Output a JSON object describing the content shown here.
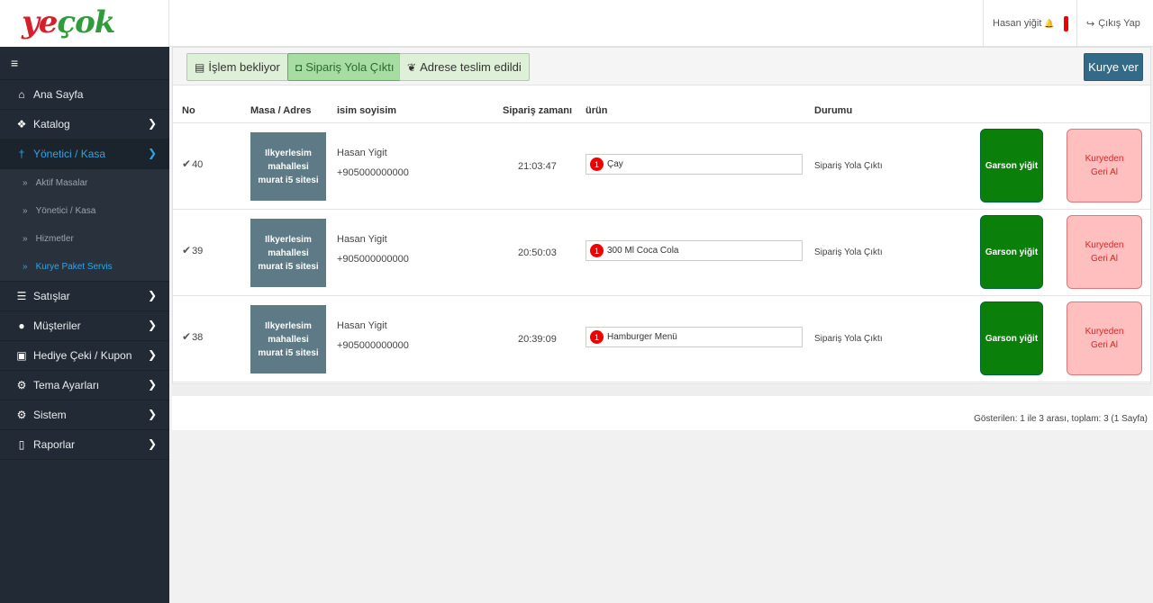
{
  "logo": {
    "part1": "ye",
    "part2": "çok"
  },
  "header": {
    "user": "Hasan yiğit",
    "logout": "Çıkış Yap"
  },
  "sidebar": {
    "toggle_icon": "≡",
    "items": [
      {
        "label": "Ana Sayfa",
        "icon": "home-icon"
      },
      {
        "label": "Katalog",
        "icon": "tags-icon"
      },
      {
        "label": "Yönetici / Kasa",
        "icon": "utensils-icon"
      },
      {
        "label": "Satışlar",
        "icon": "cart-icon"
      },
      {
        "label": "Müşteriler",
        "icon": "user-icon"
      },
      {
        "label": "Hediye Çeki / Kupon",
        "icon": "gift-icon"
      },
      {
        "label": "Tema Ayarları",
        "icon": "cogs-icon"
      },
      {
        "label": "Sistem",
        "icon": "gear-icon"
      },
      {
        "label": "Raporlar",
        "icon": "file-icon"
      }
    ],
    "sub_items": [
      "Aktif Masalar",
      "Yönetici / Kasa",
      "Hizmetler",
      "Kurye Paket Servis"
    ]
  },
  "toolbar": {
    "filter1": "İşlem bekliyor",
    "filter2": "Sipariş Yola Çıktı",
    "filter3": "Adrese teslim edildi",
    "kurye_ver": "Kurye ver"
  },
  "table": {
    "headers": {
      "no": "No",
      "address": "Masa / Adres",
      "name": "isim soyisim",
      "time": "Sipariş zamanı",
      "product": "ürün",
      "status": "Durumu"
    },
    "rows": [
      {
        "no": "40",
        "address": "Ilkyerlesim mahallesi murat i5 sitesi",
        "name": "Hasan Yigit",
        "phone": "+905000000000",
        "time": "21:03:47",
        "qty": "1",
        "product": "Çay",
        "status": "Sipariş Yola Çıktı",
        "garson": "Garson yiğit",
        "geri": "Kuryeden Geri Al"
      },
      {
        "no": "39",
        "address": "Ilkyerlesim mahallesi murat i5 sitesi",
        "name": "Hasan Yigit",
        "phone": "+905000000000",
        "time": "20:50:03",
        "qty": "1",
        "product": "300 Ml Coca Cola",
        "status": "Sipariş Yola Çıktı",
        "garson": "Garson yiğit",
        "geri": "Kuryeden Geri Al"
      },
      {
        "no": "38",
        "address": "Ilkyerlesim mahallesi murat i5 sitesi",
        "name": "Hasan Yigit",
        "phone": "+905000000000",
        "time": "20:39:09",
        "qty": "1",
        "product": "Hamburger Menü",
        "status": "Sipariş Yola Çıktı",
        "garson": "Garson yiğit",
        "geri": "Kuryeden Geri Al"
      }
    ]
  },
  "footer": {
    "pagination": "Gösterilen: 1 ile 3 arası, toplam: 3 (1 Sayfa)"
  }
}
